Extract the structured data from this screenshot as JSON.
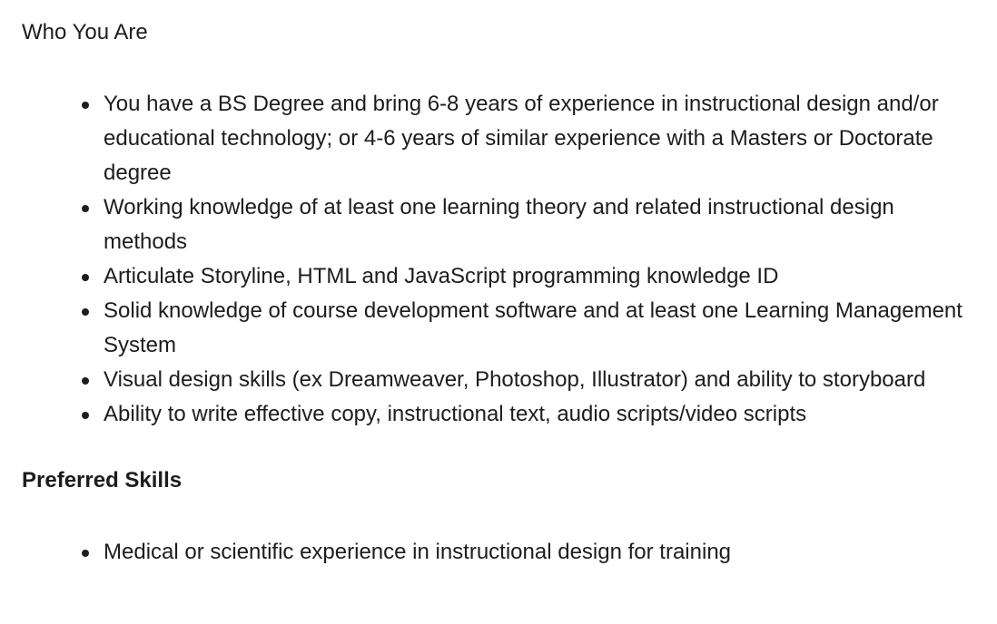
{
  "sections": [
    {
      "title": "Who You Are",
      "items": [
        "You have a BS Degree and bring 6-8 years of experience in instructional design and/or educational technology; or 4-6 years of similar experience with a Masters or Doctorate degree",
        "Working knowledge of at least one learning theory and related instructional design methods",
        "Articulate Storyline, HTML and JavaScript programming knowledge ID",
        "Solid knowledge of course development software and at least one Learning Management System",
        "Visual design skills (ex Dreamweaver, Photoshop, Illustrator) and ability to storyboard",
        "Ability to write effective copy, instructional text, audio scripts/video scripts"
      ]
    },
    {
      "title": "Preferred Skills",
      "items": [
        "Medical or scientific experience in instructional design for training"
      ]
    }
  ]
}
